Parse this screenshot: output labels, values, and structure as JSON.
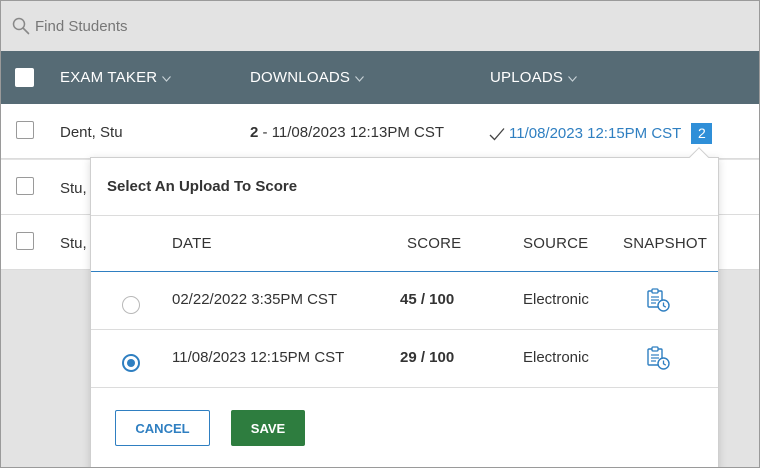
{
  "search": {
    "placeholder": "Find Students",
    "icon": "search-icon"
  },
  "table": {
    "columns": {
      "exam_taker": "EXAM TAKER",
      "downloads": "DOWNLOADS",
      "uploads": "UPLOADS"
    },
    "rows": [
      {
        "name": "Dent, Stu",
        "download_count": "2",
        "download_sep": " - ",
        "download_date": "11/08/2023 12:13PM CST",
        "upload_date": "11/08/2023 12:15PM CST",
        "upload_count": "2"
      },
      {
        "name": "Stu,"
      },
      {
        "name": "Stu,"
      }
    ]
  },
  "popover": {
    "title": "Select An Upload To Score",
    "columns": {
      "date": "DATE",
      "score": "SCORE",
      "source": "SOURCE",
      "snapshot": "SNAPSHOT"
    },
    "uploads": [
      {
        "date": "02/22/2022 3:35PM CST",
        "score": "45 / 100",
        "source": "Electronic",
        "selected": false
      },
      {
        "date": "11/08/2023 12:15PM CST",
        "score": "29 / 100",
        "source": "Electronic",
        "selected": true
      }
    ],
    "cancel_label": "CANCEL",
    "save_label": "SAVE"
  },
  "colors": {
    "header_bg": "#566b75",
    "accent": "#2f7fc1",
    "save_green": "#2e7d3f",
    "badge_blue": "#2f8fd8"
  }
}
